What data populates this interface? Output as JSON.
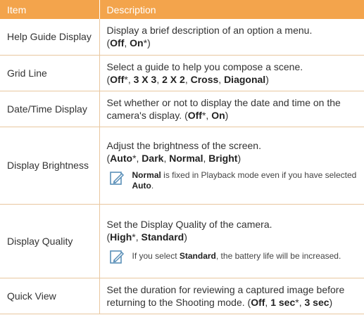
{
  "table": {
    "headers": [
      "Item",
      "Description"
    ],
    "rows": [
      {
        "item": "Help Guide Display",
        "desc_before": "Display a brief description of an option a menu.",
        "options": [
          {
            "label": "Off",
            "suffix": ""
          },
          {
            "label": "On",
            "suffix": "*"
          }
        ]
      },
      {
        "item": "Grid Line",
        "desc_before": "Select a guide to help you compose a scene.",
        "options": [
          {
            "label": "Off",
            "suffix": "*"
          },
          {
            "label": "3 X 3",
            "suffix": ""
          },
          {
            "label": "2 X 2",
            "suffix": ""
          },
          {
            "label": "Cross",
            "suffix": ""
          },
          {
            "label": "Diagonal",
            "suffix": ""
          }
        ]
      },
      {
        "item": "Date/Time Display",
        "desc_before": "Set whether or not to display the date and time on the camera's display.",
        "options": [
          {
            "label": "Off",
            "suffix": "*"
          },
          {
            "label": "On",
            "suffix": ""
          }
        ]
      },
      {
        "item": "Display Brightness",
        "desc_before": "Adjust the brightness of the screen.",
        "options": [
          {
            "label": "Auto",
            "suffix": "*"
          },
          {
            "label": "Dark",
            "suffix": ""
          },
          {
            "label": "Normal",
            "suffix": ""
          },
          {
            "label": "Bright",
            "suffix": ""
          }
        ],
        "note": {
          "bold_start": "Normal",
          "text_mid": " is fixed in Playback mode even if you have selected ",
          "bold_end": "Auto",
          "text_end": "."
        }
      },
      {
        "item": "Display Quality",
        "desc_before": "Set the Display Quality of the camera.",
        "options": [
          {
            "label": "High",
            "suffix": "*"
          },
          {
            "label": "Standard",
            "suffix": ""
          }
        ],
        "note": {
          "text_start": "If you select ",
          "bold_mid": "Standard",
          "text_end": ", the battery life will be increased."
        }
      },
      {
        "item": "Quick View",
        "desc_before": "Set the duration for reviewing a captured image before returning to the Shooting mode.",
        "options": [
          {
            "label": "Off",
            "suffix": ""
          },
          {
            "label": "1 sec",
            "suffix": "*"
          },
          {
            "label": "3 sec",
            "suffix": ""
          }
        ]
      }
    ]
  },
  "icons": {
    "note": "note-pencil-icon"
  },
  "colors": {
    "header_bg": "#f3a44c",
    "row_border": "#e9c79f"
  }
}
